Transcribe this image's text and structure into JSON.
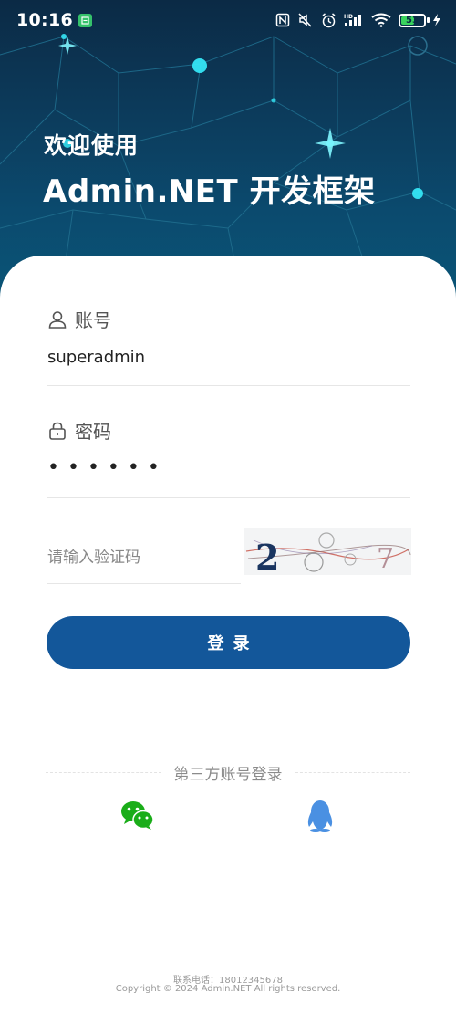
{
  "status_bar": {
    "time": "10:16",
    "battery": "53"
  },
  "hero": {
    "welcome": "欢迎使用",
    "title": "Admin.NET 开发框架"
  },
  "form": {
    "account_label": "账号",
    "account_value": "superadmin",
    "password_label": "密码",
    "password_value": "••••••",
    "captcha_placeholder": "请输入验证码",
    "captcha_image_text": "2 7",
    "login_label": "登录"
  },
  "third_party": {
    "label": "第三方账号登录",
    "icons": [
      "wechat-icon",
      "qq-icon"
    ],
    "colors": {
      "wechat": "#1aad19",
      "qq": "#4a90e2"
    }
  },
  "footer": {
    "contact": "联系电话：18012345678",
    "copyright": "Copyright © 2024 Admin.NET All rights reserved."
  },
  "theme": {
    "primary": "#13579a",
    "hero_dark": "#0b2a45",
    "accent_cyan": "#35e6f5"
  }
}
